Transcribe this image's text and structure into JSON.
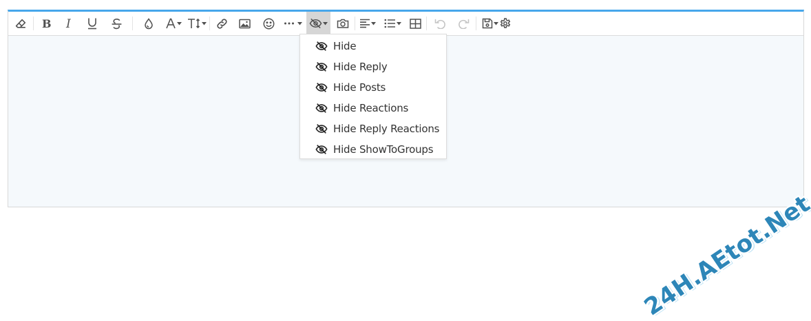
{
  "toolbar": {
    "buttons": [
      {
        "id": "remove-format",
        "icon": "eraser-icon"
      },
      {
        "id": "bold",
        "icon": "bold-icon",
        "glyph": "B"
      },
      {
        "id": "italic",
        "icon": "italic-icon",
        "glyph": "I"
      },
      {
        "id": "underline",
        "icon": "underline-icon",
        "glyph": "U"
      },
      {
        "id": "strike",
        "icon": "strikethrough-icon",
        "glyph": "S"
      },
      {
        "id": "color",
        "icon": "text-color-icon"
      },
      {
        "id": "font-family",
        "icon": "font-family-icon",
        "glyph": "A"
      },
      {
        "id": "font-size",
        "icon": "font-size-icon",
        "glyph": "T"
      },
      {
        "id": "link",
        "icon": "link-icon"
      },
      {
        "id": "image",
        "icon": "image-icon"
      },
      {
        "id": "smilies",
        "icon": "smiley-icon"
      },
      {
        "id": "more",
        "icon": "more-options-icon"
      },
      {
        "id": "hide",
        "icon": "eye-slash-icon",
        "active": true
      },
      {
        "id": "media",
        "icon": "camera-icon"
      },
      {
        "id": "align",
        "icon": "align-left-icon"
      },
      {
        "id": "list",
        "icon": "list-icon"
      },
      {
        "id": "table",
        "icon": "table-icon"
      },
      {
        "id": "undo",
        "icon": "undo-icon",
        "disabled": true
      },
      {
        "id": "redo",
        "icon": "redo-icon",
        "disabled": true
      },
      {
        "id": "drafts",
        "icon": "save-draft-icon"
      },
      {
        "id": "settings",
        "icon": "gear-icon"
      }
    ],
    "accent_color": "#47a7eb"
  },
  "hide_menu": {
    "items": [
      {
        "label": "Hide",
        "icon": "eye-slash-icon"
      },
      {
        "label": "Hide Reply",
        "icon": "eye-slash-icon"
      },
      {
        "label": "Hide Posts",
        "icon": "eye-slash-icon"
      },
      {
        "label": "Hide Reactions",
        "icon": "eye-slash-icon"
      },
      {
        "label": "Hide Reply Reactions",
        "icon": "eye-slash-icon"
      },
      {
        "label": "Hide ShowToGroups",
        "icon": "eye-slash-icon"
      }
    ]
  },
  "watermark": {
    "text": "24H.AEtot.Net"
  }
}
